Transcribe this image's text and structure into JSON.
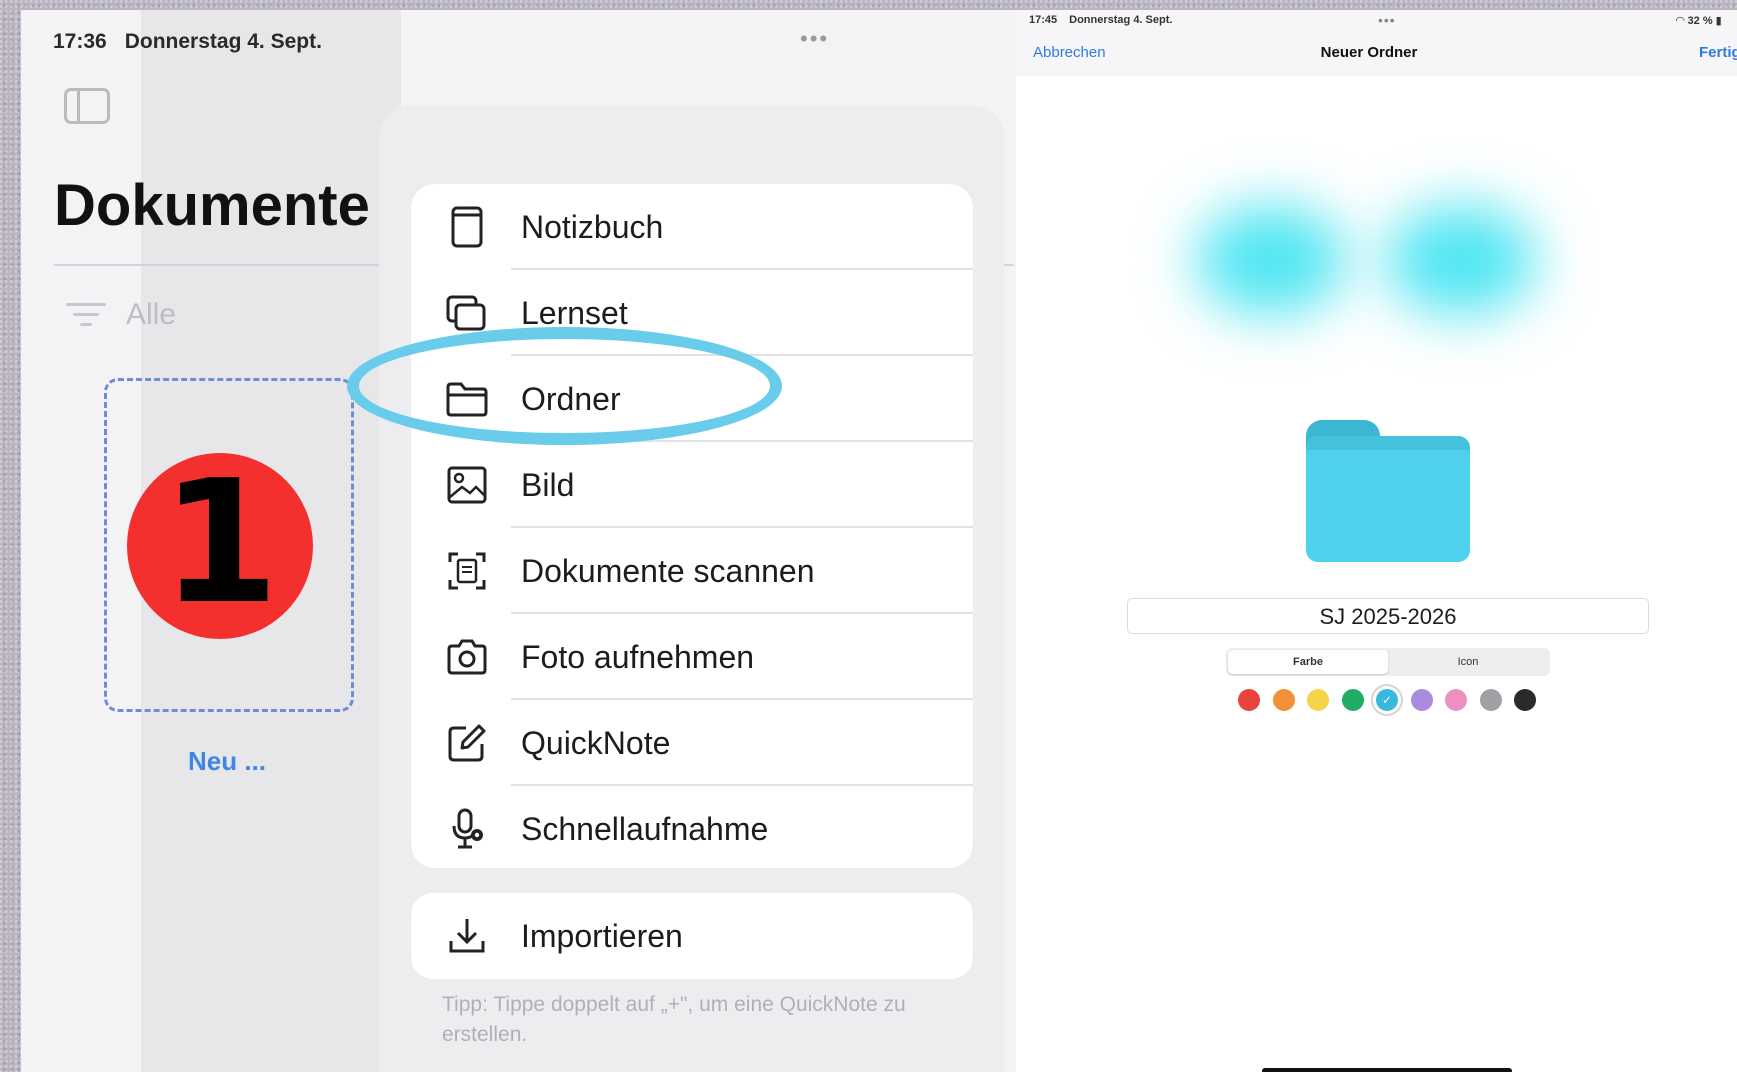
{
  "left": {
    "status_time": "17:36",
    "status_date": "Donnerstag 4. Sept.",
    "dots": "•••",
    "title": "Dokumente",
    "filter_label": "Alle",
    "step_number": "1",
    "new_label": "Neu ..."
  },
  "menu": {
    "items": [
      {
        "label": "Notizbuch",
        "icon": "notebook-icon"
      },
      {
        "label": "Lernset",
        "icon": "cards-icon"
      },
      {
        "label": "Ordner",
        "icon": "folder-icon"
      },
      {
        "label": "Bild",
        "icon": "image-icon"
      },
      {
        "label": "Dokumente scannen",
        "icon": "scan-icon"
      },
      {
        "label": "Foto aufnehmen",
        "icon": "camera-icon"
      },
      {
        "label": "QuickNote",
        "icon": "quicknote-icon"
      },
      {
        "label": "Schnellaufnahme",
        "icon": "microphone-icon"
      }
    ],
    "import_label": "Importieren",
    "import_icon": "download-icon",
    "tip": "Tipp: Tippe doppelt auf „+\", um eine QuickNote zu erstellen."
  },
  "right": {
    "status_time": "17:45",
    "status_date": "Donnerstag 4. Sept.",
    "dots": "•••",
    "battery": "32 %",
    "cancel_label": "Abbrechen",
    "title": "Neuer Ordner",
    "done_label": "Fertig",
    "folder_name": "SJ 2025-2026",
    "segment_color": "Farbe",
    "segment_icon": "Icon",
    "swatches": [
      "#e8443c",
      "#f0913a",
      "#f4d54a",
      "#1fae63",
      "#37b8dc",
      "#a98be0",
      "#ee8fc2",
      "#a0a0a4",
      "#2b2b2d"
    ],
    "selected_swatch": "#37b8dc",
    "folder_color": "#4fd0ed",
    "highlight_color": "#69ccea"
  }
}
